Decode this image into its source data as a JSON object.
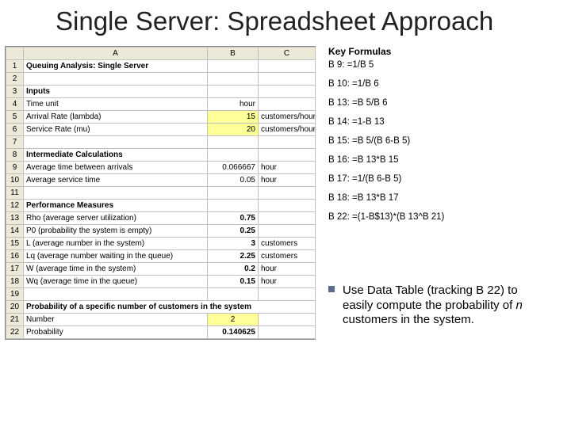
{
  "title": "Single Server: Spreadsheet Approach",
  "columns": {
    "rowhdr": "",
    "A": "A",
    "B": "B",
    "C": "C"
  },
  "rows": [
    {
      "n": "1",
      "A": "Queuing Analysis: Single Server",
      "A_bold": true
    },
    {
      "n": "2",
      "A": ""
    },
    {
      "n": "3",
      "A": "Inputs",
      "A_bold": true
    },
    {
      "n": "4",
      "A": "Time unit",
      "B": "hour",
      "B_align": "right"
    },
    {
      "n": "5",
      "A": "Arrival Rate (lambda)",
      "B": "15",
      "B_align": "right",
      "B_hl": true,
      "C": "customers/hour"
    },
    {
      "n": "6",
      "A": "Service Rate (mu)",
      "B": "20",
      "B_align": "right",
      "B_hl": true,
      "C": "customers/hour"
    },
    {
      "n": "7",
      "A": ""
    },
    {
      "n": "8",
      "A": "Intermediate Calculations",
      "A_bold": true
    },
    {
      "n": "9",
      "A": "Average time between arrivals",
      "B": "0.066667",
      "B_align": "right",
      "C": "hour"
    },
    {
      "n": "10",
      "A": "Average service time",
      "B": "0.05",
      "B_align": "right",
      "C": "hour"
    },
    {
      "n": "11",
      "A": ""
    },
    {
      "n": "12",
      "A": "Performance Measures",
      "A_bold": true
    },
    {
      "n": "13",
      "A": "Rho (average server utilization)",
      "B": "0.75",
      "B_align": "right",
      "B_bold": true
    },
    {
      "n": "14",
      "A": "P0 (probability the system is empty)",
      "B": "0.25",
      "B_align": "right",
      "B_bold": true
    },
    {
      "n": "15",
      "A": "L (average number in the system)",
      "B": "3",
      "B_align": "right",
      "B_bold": true,
      "C": "customers"
    },
    {
      "n": "16",
      "A": "Lq (average number waiting in the queue)",
      "B": "2.25",
      "B_align": "right",
      "B_bold": true,
      "C": "customers"
    },
    {
      "n": "17",
      "A": "W (average time in the system)",
      "B": "0.2",
      "B_align": "right",
      "B_bold": true,
      "C": "hour"
    },
    {
      "n": "18",
      "A": "Wq (average time in the queue)",
      "B": "0.15",
      "B_align": "right",
      "B_bold": true,
      "C": "hour"
    },
    {
      "n": "19",
      "A": ""
    },
    {
      "n": "20",
      "A": "Probability of a specific number of customers in the system",
      "A_bold": true
    },
    {
      "n": "21",
      "A": "Number",
      "B": "2",
      "B_align": "center",
      "B_hl": true
    },
    {
      "n": "22",
      "A": "Probability",
      "B": "0.140625",
      "B_align": "right",
      "B_bold": true
    }
  ],
  "formulas_title": "Key Formulas",
  "formulas": [
    "B 9: =1/B 5",
    "B 10: =1/B 6",
    "B 13: =B 5/B 6",
    "B 14: =1-B 13",
    "B 15: =B 5/(B 6-B 5)",
    "B 16: =B 13*B 15",
    "B 17: =1/(B 6-B 5)",
    "B 18: =B 13*B 17",
    "B 22: =(1-B$13)*(B 13^B 21)"
  ],
  "note": {
    "pre": "Use Data Table (tracking B 22) to easily compute the probability of ",
    "n": "n",
    "post": " customers in the system."
  }
}
